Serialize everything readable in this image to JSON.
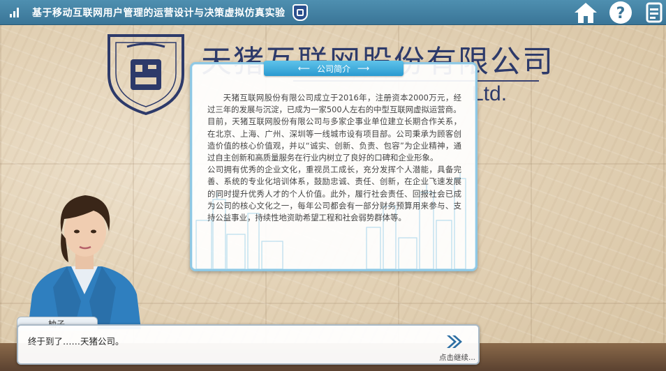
{
  "header": {
    "title": "基于移动互联网用户管理的运营设计与决策虚拟仿真实验",
    "icons": {
      "stats": "bar-chart-icon",
      "emblem": "university-emblem-icon",
      "home": "home-icon",
      "help": "help-icon",
      "menu": "menu-icon"
    }
  },
  "scene": {
    "company_sign": "天猪互联网股份有限公司",
    "company_sign_en": "Ltd."
  },
  "intro_panel": {
    "title": "公司简介",
    "paragraphs": [
      "天猪互联网股份有限公司成立于2016年，注册资本2000万元，经过三年的发展与沉淀，已成为一家500人左右的中型互联网虚拟运营商。",
      "目前，天猪互联网股份有限公司与多家企事业单位建立长期合作关系，在北京、上海、广州、深圳等一线城市设有项目部。公司秉承为顾客创造价值的核心价值观，并以“诚实、创新、负责、包容”为企业精神，通过自主创新和高质量服务在行业内树立了良好的口碑和企业形象。",
      "公司拥有优秀的企业文化，重视员工成长，充分发挥个人潜能，具备完善、系统的专业化培训体系，鼓励忠诚、责任、创新，在企业飞速发展的同时提升优秀人才的个人价值。此外，履行社会责任、回报社会已成为公司的核心文化之一，每年公司都会有一部分财务预算用来参与、支持公益事业，持续性地资助希望工程和社会弱势群体等。"
    ]
  },
  "dialog": {
    "speaker": "柚子",
    "text": "终于到了……天猪公司。",
    "continue_label": "点击继续..."
  },
  "colors": {
    "topbar": "#3f7ea0",
    "panel_border": "#8fc8e4",
    "tab": "#2a9ad0",
    "sign_text": "#2d3a6a"
  }
}
